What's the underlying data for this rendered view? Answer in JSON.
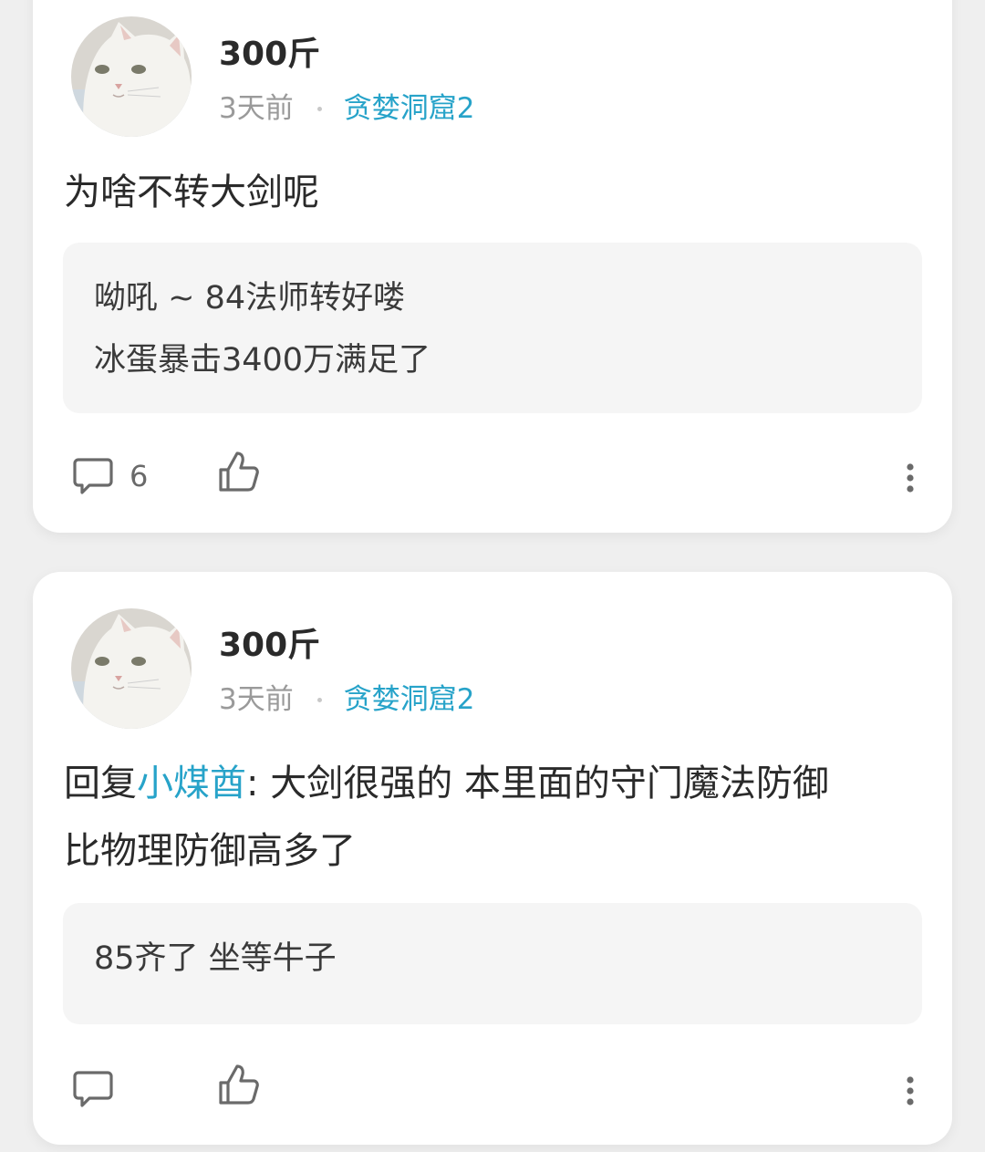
{
  "posts": [
    {
      "username": "300斤",
      "time": "3天前",
      "group": "贪婪洞窟2",
      "body": "为啥不转大剑呢",
      "quote_lines": [
        "呦吼 ~ 84法师转好喽",
        "冰蛋暴击3400万满足了"
      ],
      "comment_count": "6"
    },
    {
      "username": "300斤",
      "time": "3天前",
      "group": "贪婪洞窟2",
      "reply_prefix": "回复",
      "reply_to": "小煤酋",
      "reply_separator": ": ",
      "body_line1": "大剑很强的 本里面的守门魔法防御",
      "body_line2": "比物理防御高多了",
      "quote_lines": [
        "85齐了 坐等牛子"
      ]
    }
  ],
  "icons": {
    "avatar": "white-cat-avatar",
    "comment": "comment-bubble-icon",
    "like": "thumbs-up-icon",
    "more": "more-vertical-icon"
  },
  "colors": {
    "accent": "#27a3c9",
    "text": "#2a2a2a",
    "muted": "#9a9a9a",
    "quote_bg": "#f5f5f5"
  }
}
